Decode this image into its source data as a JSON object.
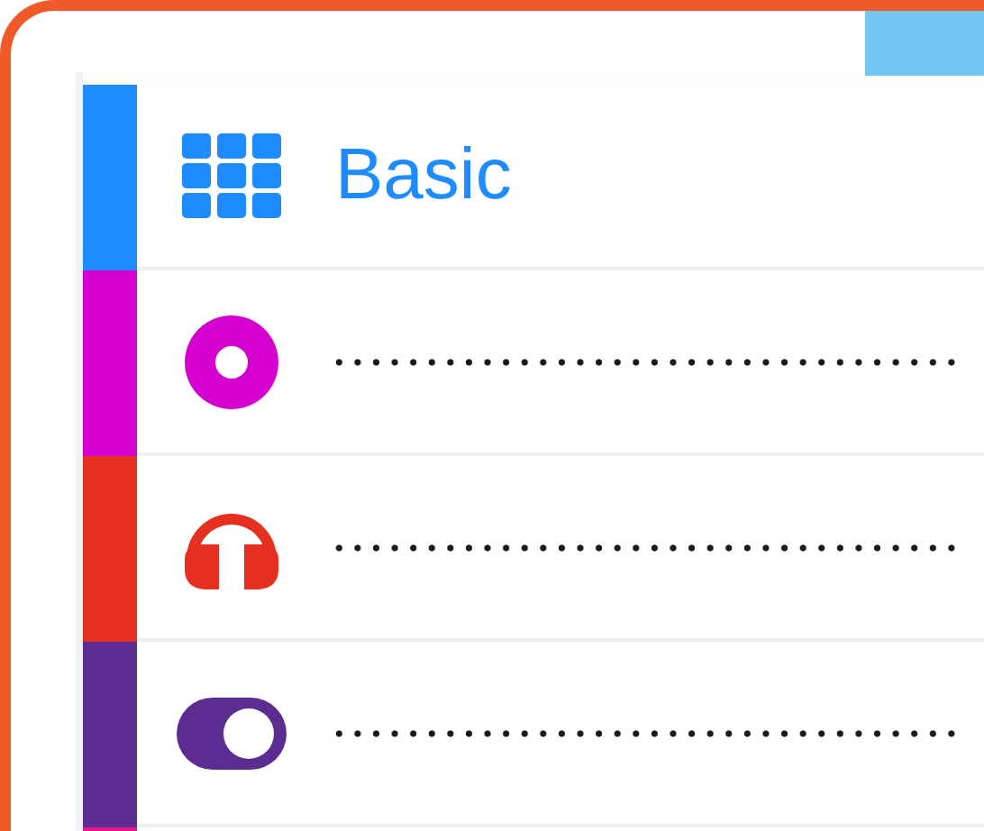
{
  "rows": [
    {
      "kind": "grid",
      "color": "#1e8cff",
      "label": "Basic"
    },
    {
      "kind": "disc",
      "color": "#d400d0"
    },
    {
      "kind": "headphones",
      "color": "#e53020"
    },
    {
      "kind": "toggle",
      "color": "#5c2d91"
    },
    {
      "kind": "partial",
      "color": "#e8168a"
    }
  ]
}
